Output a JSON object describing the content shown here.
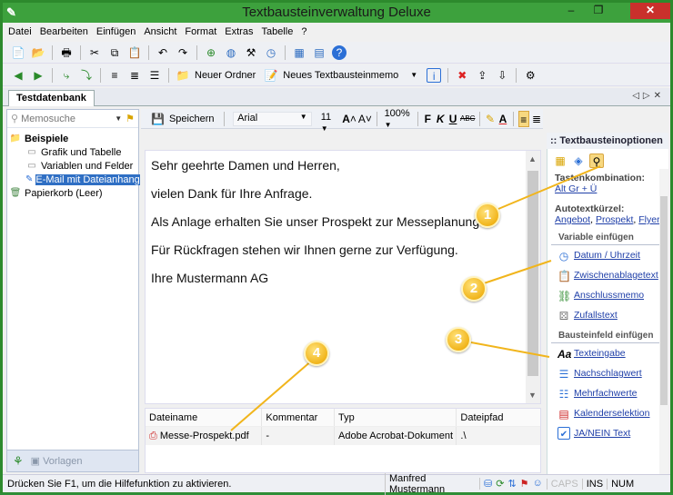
{
  "window": {
    "title": "Textbausteinverwaltung Deluxe"
  },
  "menu": [
    "Datei",
    "Bearbeiten",
    "Einfügen",
    "Ansicht",
    "Format",
    "Extras",
    "Tabelle",
    "?"
  ],
  "toolbar2": {
    "new_folder": "Neuer Ordner",
    "new_memo": "Neues Textbausteinmemo"
  },
  "tab": {
    "label": "Testdatenbank"
  },
  "left": {
    "search_placeholder": "Memosuche",
    "tree_root": "Beispiele",
    "tree_items": [
      "Grafik und Tabelle",
      "Variablen und Felder",
      "E-Mail mit Dateianhang"
    ],
    "trash": "Papierkorb (Leer)",
    "bottom_tab": "Vorlagen"
  },
  "editor_toolbar": {
    "save": "Speichern",
    "font": "Arial",
    "size": "11",
    "zoom": "100%"
  },
  "editor": {
    "paragraphs": [
      "Sehr geehrte Damen und Herren,",
      "vielen Dank für Ihre Anfrage.",
      "Als Anlage erhalten Sie unser Prospekt zur Messeplanung.",
      "Für Rückfragen stehen wir Ihnen gerne zur Verfügung.",
      "Ihre Mustermann AG"
    ]
  },
  "attachments": {
    "headers": [
      "Dateiname",
      "Kommentar",
      "Typ",
      "Dateipfad"
    ],
    "row": [
      "Messe-Prospekt.pdf",
      "-",
      "Adobe Acrobat-Dokument",
      ".\\"
    ]
  },
  "options": {
    "title": ":: Textbausteinoptionen",
    "shortcut_label": "Tastenkombination:",
    "shortcut_value": "Alt Gr + Ü",
    "autotext_label": "Autotextkürzel:",
    "autotext_links": [
      "Angebot",
      "Prospekt",
      "Flyer"
    ],
    "var_group": "Variable einfügen",
    "var_items": [
      "Datum / Uhrzeit",
      "Zwischenablagetext",
      "Anschlussmemo",
      "Zufallstext"
    ],
    "field_group": "Bausteinfeld einfügen",
    "field_items": [
      "Texteingabe",
      "Nachschlagwert",
      "Mehrfachwerte",
      "Kalenderselektion",
      "JA/NEIN Text"
    ]
  },
  "status": {
    "message": "Drücken Sie F1, um die Hilfefunktion zu aktivieren.",
    "user": "Manfred Mustermann",
    "caps": "CAPS",
    "ins": "INS",
    "num": "NUM"
  },
  "callouts": [
    "1",
    "2",
    "3",
    "4"
  ],
  "colors": {
    "frame": "#2d8a2d",
    "callout": "#f1b51c",
    "selection": "#2f6fc4",
    "link": "#1f3fa8"
  }
}
